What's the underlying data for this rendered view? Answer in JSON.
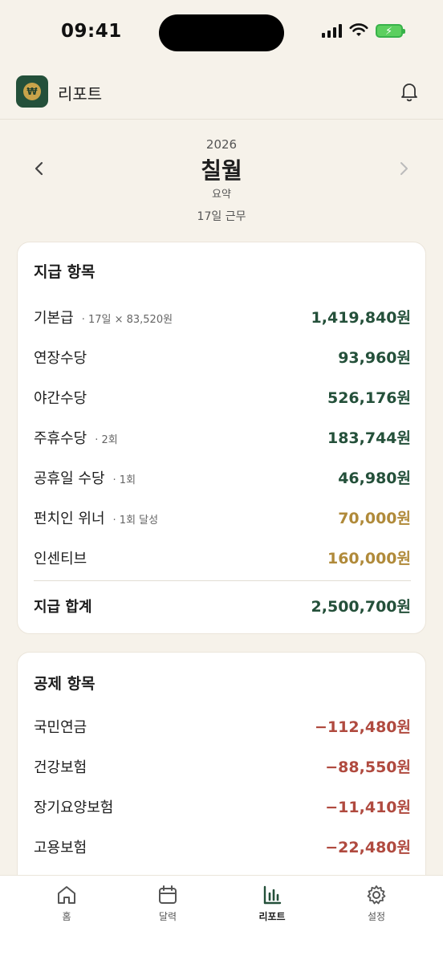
{
  "status_bar": {
    "time": "09:41"
  },
  "app": {
    "title": "리포트",
    "logo_symbol": "₩"
  },
  "period": {
    "year": "2026",
    "month": "칠월",
    "subtitle": "요약",
    "work_days": "17일 근무"
  },
  "earnings": {
    "title": "지급 항목",
    "items": [
      {
        "label": "기본급",
        "note": "· 17일 × 83,520원",
        "amount": "1,419,840원"
      },
      {
        "label": "연장수당",
        "note": "",
        "amount": "93,960원"
      },
      {
        "label": "야간수당",
        "note": "",
        "amount": "526,176원"
      },
      {
        "label": "주휴수당",
        "note": "· 2회",
        "amount": "183,744원"
      },
      {
        "label": "공휴일 수당",
        "note": "· 1회",
        "amount": "46,980원"
      },
      {
        "label": "펀치인 위너",
        "note": "· 1회 달성",
        "amount": "70,000원"
      },
      {
        "label": "인센티브",
        "note": "",
        "amount": "160,000원"
      }
    ],
    "total_label": "지급 합계",
    "total_amount": "2,500,700원"
  },
  "deductions": {
    "title": "공제 항목",
    "items": [
      {
        "label": "국민연금",
        "amount": "−112,480원"
      },
      {
        "label": "건강보험",
        "amount": "−88,550원"
      },
      {
        "label": "장기요양보험",
        "amount": "−11,410원"
      },
      {
        "label": "고용보험",
        "amount": "−22,480원"
      }
    ]
  },
  "nav": {
    "items": [
      {
        "label": "홈",
        "icon": "home-icon"
      },
      {
        "label": "달력",
        "icon": "calendar-icon"
      },
      {
        "label": "리포트",
        "icon": "bar-chart-icon"
      },
      {
        "label": "설정",
        "icon": "gear-icon"
      }
    ],
    "active_index": 2
  },
  "colors": {
    "background": "#f6f2ea",
    "brand_green": "#24503a",
    "gold": "#b08a3a",
    "negative": "#b04a3f"
  }
}
